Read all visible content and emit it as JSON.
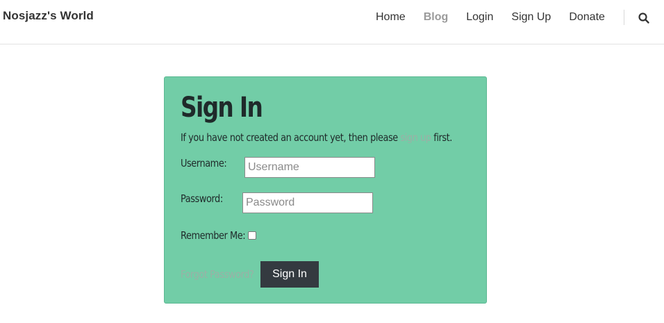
{
  "header": {
    "brand": "Nosjazz's World",
    "nav": [
      {
        "label": "Home",
        "active": false
      },
      {
        "label": "Blog",
        "active": true
      },
      {
        "label": "Login",
        "active": false
      },
      {
        "label": "Sign Up",
        "active": false
      },
      {
        "label": "Donate",
        "active": false
      }
    ],
    "search_icon": "search-icon"
  },
  "signin": {
    "title": "Sign In",
    "intro_before": "If you have not created an account yet, then please ",
    "intro_link": "sign up",
    "intro_after": " first.",
    "username_label": "Username:",
    "username_placeholder": "Username",
    "password_label": "Password:",
    "password_placeholder": "Password",
    "remember_label": "Remember Me:",
    "remember_checked": false,
    "forgot_label": "Forgot Password?",
    "submit_label": "Sign In"
  },
  "colors": {
    "card_bg": "#72cda7",
    "button_bg": "#343a40",
    "link_muted": "#9bb0a6",
    "nav_active": "#9a9a9a"
  }
}
